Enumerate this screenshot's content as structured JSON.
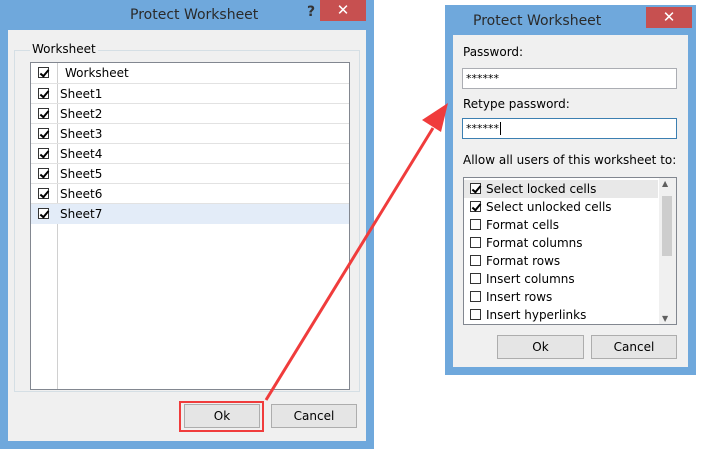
{
  "left_dialog": {
    "title": "Protect Worksheet",
    "help": "?",
    "close": "✕",
    "group_label": "Worksheet",
    "header": "Worksheet",
    "sheets": [
      {
        "label": "Sheet1",
        "checked": true
      },
      {
        "label": "Sheet2",
        "checked": true
      },
      {
        "label": "Sheet3",
        "checked": true
      },
      {
        "label": "Sheet4",
        "checked": true
      },
      {
        "label": "Sheet5",
        "checked": true
      },
      {
        "label": "Sheet6",
        "checked": true
      },
      {
        "label": "Sheet7",
        "checked": true
      }
    ],
    "ok": "Ok",
    "cancel": "Cancel"
  },
  "right_dialog": {
    "title": "Protect Worksheet",
    "close": "✕",
    "password_label": "Password:",
    "password_value": "******",
    "retype_label": "Retype password:",
    "retype_value": "******",
    "allow_label": "Allow all users of this worksheet to:",
    "permissions": [
      {
        "label": "Select locked cells",
        "checked": true
      },
      {
        "label": "Select unlocked cells",
        "checked": true
      },
      {
        "label": "Format cells",
        "checked": false
      },
      {
        "label": "Format columns",
        "checked": false
      },
      {
        "label": "Format rows",
        "checked": false
      },
      {
        "label": "Insert columns",
        "checked": false
      },
      {
        "label": "Insert rows",
        "checked": false
      },
      {
        "label": "Insert hyperlinks",
        "checked": false
      }
    ],
    "ok": "Ok",
    "cancel": "Cancel"
  },
  "colors": {
    "frame": "#6fa8dc",
    "close": "#c75050",
    "highlight": "#f03c3c",
    "selected_row": "#e3ecf8"
  }
}
